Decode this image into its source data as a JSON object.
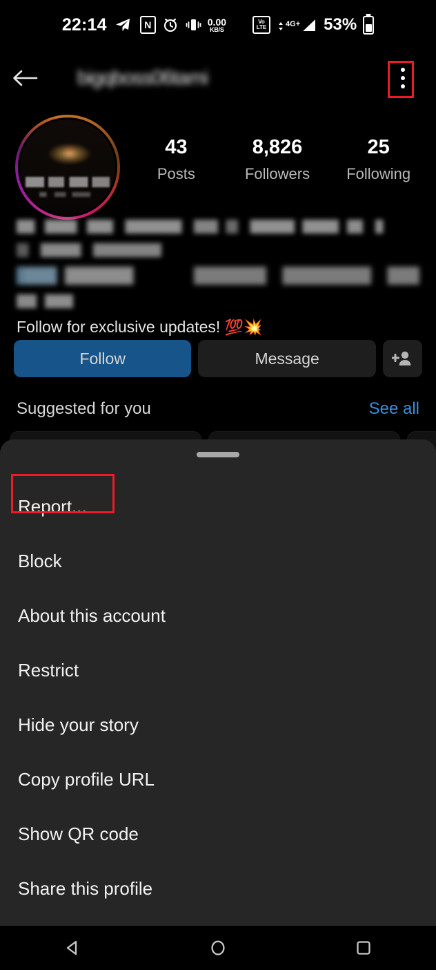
{
  "status_bar": {
    "time": "22:14",
    "icons": [
      {
        "name": "telegram-icon",
        "label": "telegram"
      },
      {
        "name": "nfc-icon",
        "label": "N"
      },
      {
        "name": "alarm-icon",
        "label": "alarm"
      },
      {
        "name": "vibrate-icon",
        "label": "vibrate"
      }
    ],
    "data_rate_value": "0.00",
    "data_rate_unit": "KB/S",
    "volte_top": "Vo",
    "volte_bottom": "LTE",
    "network_type": "4G+",
    "battery_percent": "53%"
  },
  "app_bar": {
    "back_icon": "arrow-left-icon",
    "username": "bigqboss06tami",
    "more_icon": "more-vertical-icon"
  },
  "profile": {
    "avatar_alt": "profile-picture-with-story-ring",
    "stats": [
      {
        "value": "43",
        "label": "Posts"
      },
      {
        "value": "8,826",
        "label": "Followers"
      },
      {
        "value": "25",
        "label": "Following"
      }
    ],
    "bio_cta": "Follow for exclusive updates!",
    "bio_emoji_1": "💯",
    "bio_emoji_2": "💥"
  },
  "actions": {
    "follow_label": "Follow",
    "message_label": "Message",
    "add_person_icon": "add-person-icon",
    "follow_color": "#17548a",
    "secondary_color": "#1e1e1e"
  },
  "suggested": {
    "title": "Suggested for you",
    "see_all_label": "See all",
    "see_all_color": "#3a8fdc"
  },
  "bottom_sheet": {
    "menu_items": [
      {
        "label": "Report...",
        "highlighted": true
      },
      {
        "label": "Block",
        "highlighted": false
      },
      {
        "label": "About this account",
        "highlighted": false
      },
      {
        "label": "Restrict",
        "highlighted": false
      },
      {
        "label": "Hide your story",
        "highlighted": false
      },
      {
        "label": "Copy profile URL",
        "highlighted": false
      },
      {
        "label": "Show QR code",
        "highlighted": false
      },
      {
        "label": "Share this profile",
        "highlighted": false
      }
    ],
    "background_color": "#262626"
  },
  "annotations": {
    "color": "#ee1b26",
    "targets": [
      "more-options-button",
      "report-menu-item"
    ]
  },
  "nav_bar": {
    "back_icon": "nav-back-triangle-icon",
    "home_icon": "nav-home-circle-icon",
    "recents_icon": "nav-recents-square-icon"
  }
}
